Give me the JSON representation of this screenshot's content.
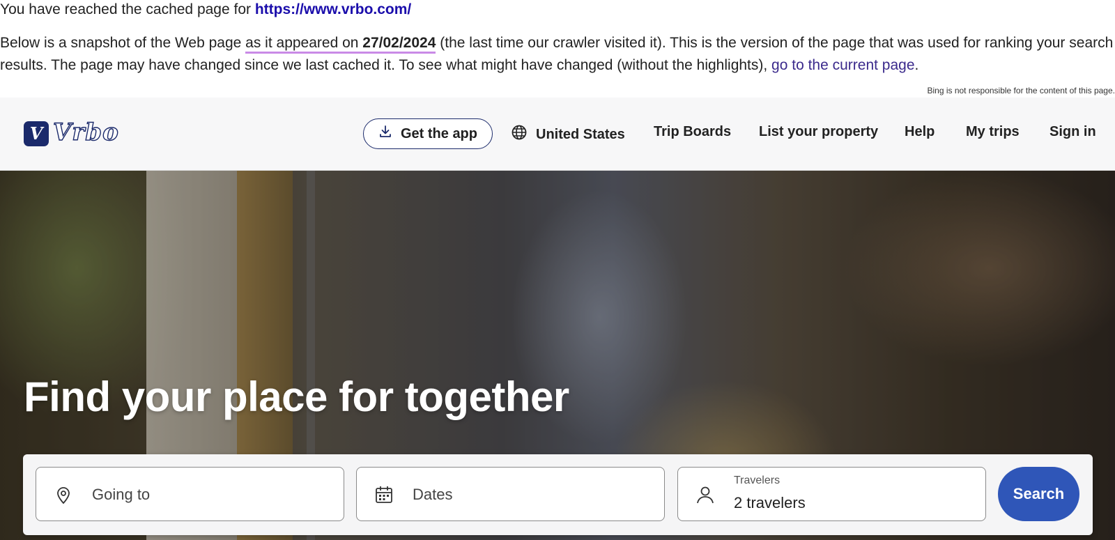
{
  "cache_banner": {
    "line1_prefix": "You have reached the cached page for ",
    "url": "https://www.vrbo.com/",
    "line2_a": "Below is a snapshot of the Web page ",
    "line2_highlight": "as it appeared on ",
    "date": "27/02/2024",
    "line2_b": " (the last time our crawler visited it). This is the version of the page that was used for ranking your search results. The page may have changed since we last cached it. To see what might have changed (without the highlights), ",
    "current_link": "go to the current page",
    "line2_end": ".",
    "disclaimer": "Bing is not responsible for the content of this page."
  },
  "header": {
    "logo_mark": "V",
    "logo_word": "Vrbo",
    "get_app": "Get the app",
    "nav": {
      "region": "United States",
      "trip_boards": "Trip Boards",
      "list_property": "List your property",
      "help": "Help",
      "my_trips": "My trips",
      "sign_in": "Sign in"
    }
  },
  "hero": {
    "title": "Find your place for together"
  },
  "search": {
    "destination_placeholder": "Going to",
    "dates_placeholder": "Dates",
    "travelers_label": "Travelers",
    "travelers_value": "2 travelers",
    "button": "Search"
  },
  "colors": {
    "brand_navy": "#1b2a6b",
    "search_button": "#2f56b8",
    "highlight_underline": "#c98ae6",
    "link": "#1a0dab"
  }
}
